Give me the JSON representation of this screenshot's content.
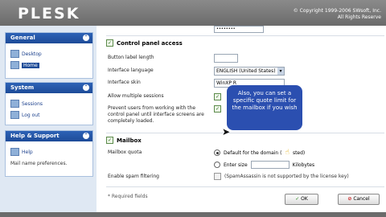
{
  "header": {
    "logo": "PLESK",
    "copyright_1": "© Copyright 1999-2006 SWsoft, Inc.",
    "copyright_2": "All Rights Reserve"
  },
  "sidebar": {
    "general": {
      "title": "General",
      "items": [
        "Desktop",
        "Home"
      ]
    },
    "system": {
      "title": "System",
      "items": [
        "Sessions",
        "Log out"
      ]
    },
    "help": {
      "title": "Help & Support",
      "items": [
        "Help"
      ],
      "text": "Mail name preferences."
    }
  },
  "form": {
    "cp_section": "Control panel access",
    "button_label_length": "Button label length",
    "interface_language": "Interface language",
    "interface_language_value": "ENGLISH (United States)",
    "interface_skin": "Interface skin",
    "interface_skin_value": "WinXP R",
    "allow_multiple_sessions": "Allow multiple sessions",
    "prevent_users_1": "Prevent users from working with the",
    "prevent_users_2": "control panel until interface screens are",
    "prevent_users_3": "completely loaded.",
    "mailbox_section": "Mailbox",
    "mailbox_quota": "Mailbox quota",
    "quota_default": "Default for the domain (",
    "quota_default_end": "sted)",
    "enter_size": "Enter size",
    "kilobytes": "Kilobytes",
    "spam_filtering": "Enable spam filtering",
    "spam_note": "(SpamAssassin is not supported by the license key)",
    "required": "* Required fields",
    "ok": "OK",
    "cancel": "Cancel"
  },
  "tooltip": {
    "text": "Also, you can set a specific quote limit for the mailbox if you wish"
  }
}
